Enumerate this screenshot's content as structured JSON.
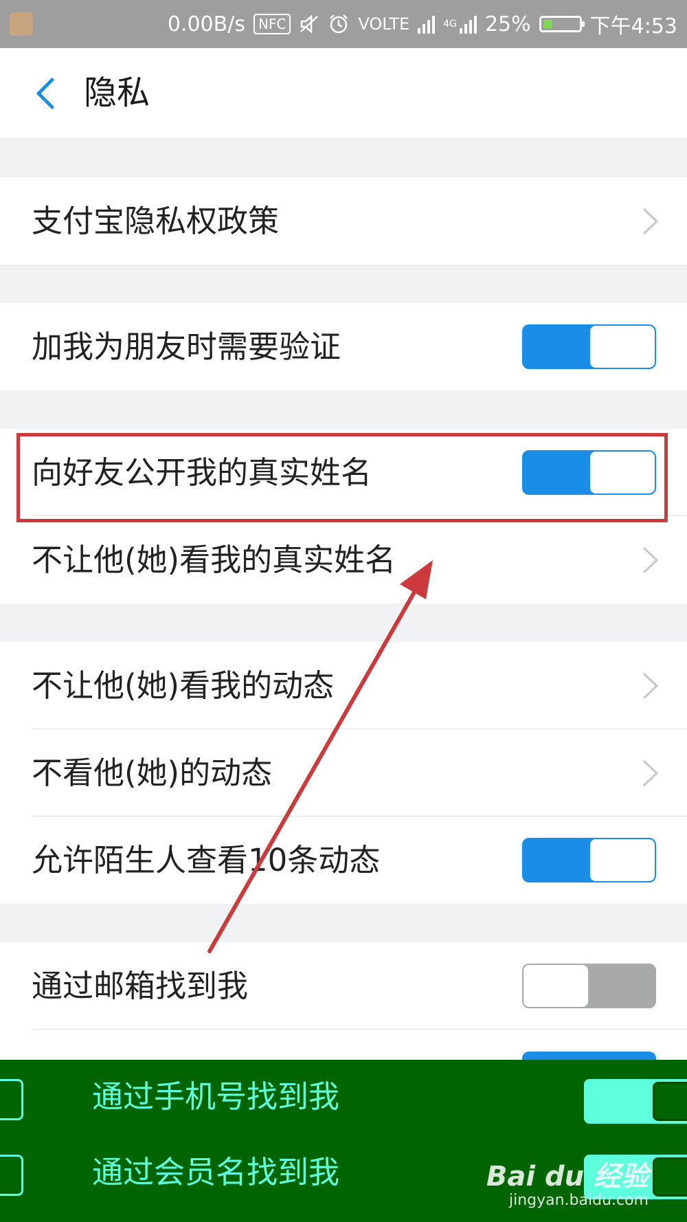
{
  "status_bar": {
    "speed": "0.00B/s",
    "nfc": "NFC",
    "network": "VOLTE",
    "network_4g": "4G",
    "battery_percent": "25%",
    "battery_level": 0.25,
    "time": "下午4:53"
  },
  "header": {
    "title": "隐私",
    "back_icon": "chevron-left-icon"
  },
  "sections": [
    {
      "rows": [
        {
          "label": "支付宝隐私权政策",
          "control": "chevron"
        }
      ]
    },
    {
      "rows": [
        {
          "label": "加我为朋友时需要验证",
          "control": "toggle",
          "state": "on"
        }
      ]
    },
    {
      "rows": [
        {
          "label": "向好友公开我的真实姓名",
          "control": "toggle",
          "state": "on"
        },
        {
          "label": "不让他(她)看我的真实姓名",
          "control": "chevron"
        }
      ]
    },
    {
      "rows": [
        {
          "label": "不让他(她)看我的动态",
          "control": "chevron"
        },
        {
          "label": "不看他(她)的动态",
          "control": "chevron"
        },
        {
          "label": "允许陌生人查看10条动态",
          "control": "toggle",
          "state": "on"
        }
      ]
    },
    {
      "rows": [
        {
          "label": "通过邮箱找到我",
          "control": "toggle",
          "state": "off"
        },
        {
          "label": "通过手机号找到我",
          "control": "toggle",
          "state": "on"
        },
        {
          "label": "通过会员名找到我",
          "control": "toggle",
          "state": "on"
        }
      ]
    }
  ],
  "colors": {
    "accent": "#1a8ee6",
    "toggle_off": "#a8aaa9",
    "annotation": "#cc3a3c",
    "glitch_bg": "#006400",
    "glitch_fg": "#5effdc"
  },
  "watermark": {
    "logo": "Bai du 经验",
    "url": "jingyan.baidu.com"
  }
}
